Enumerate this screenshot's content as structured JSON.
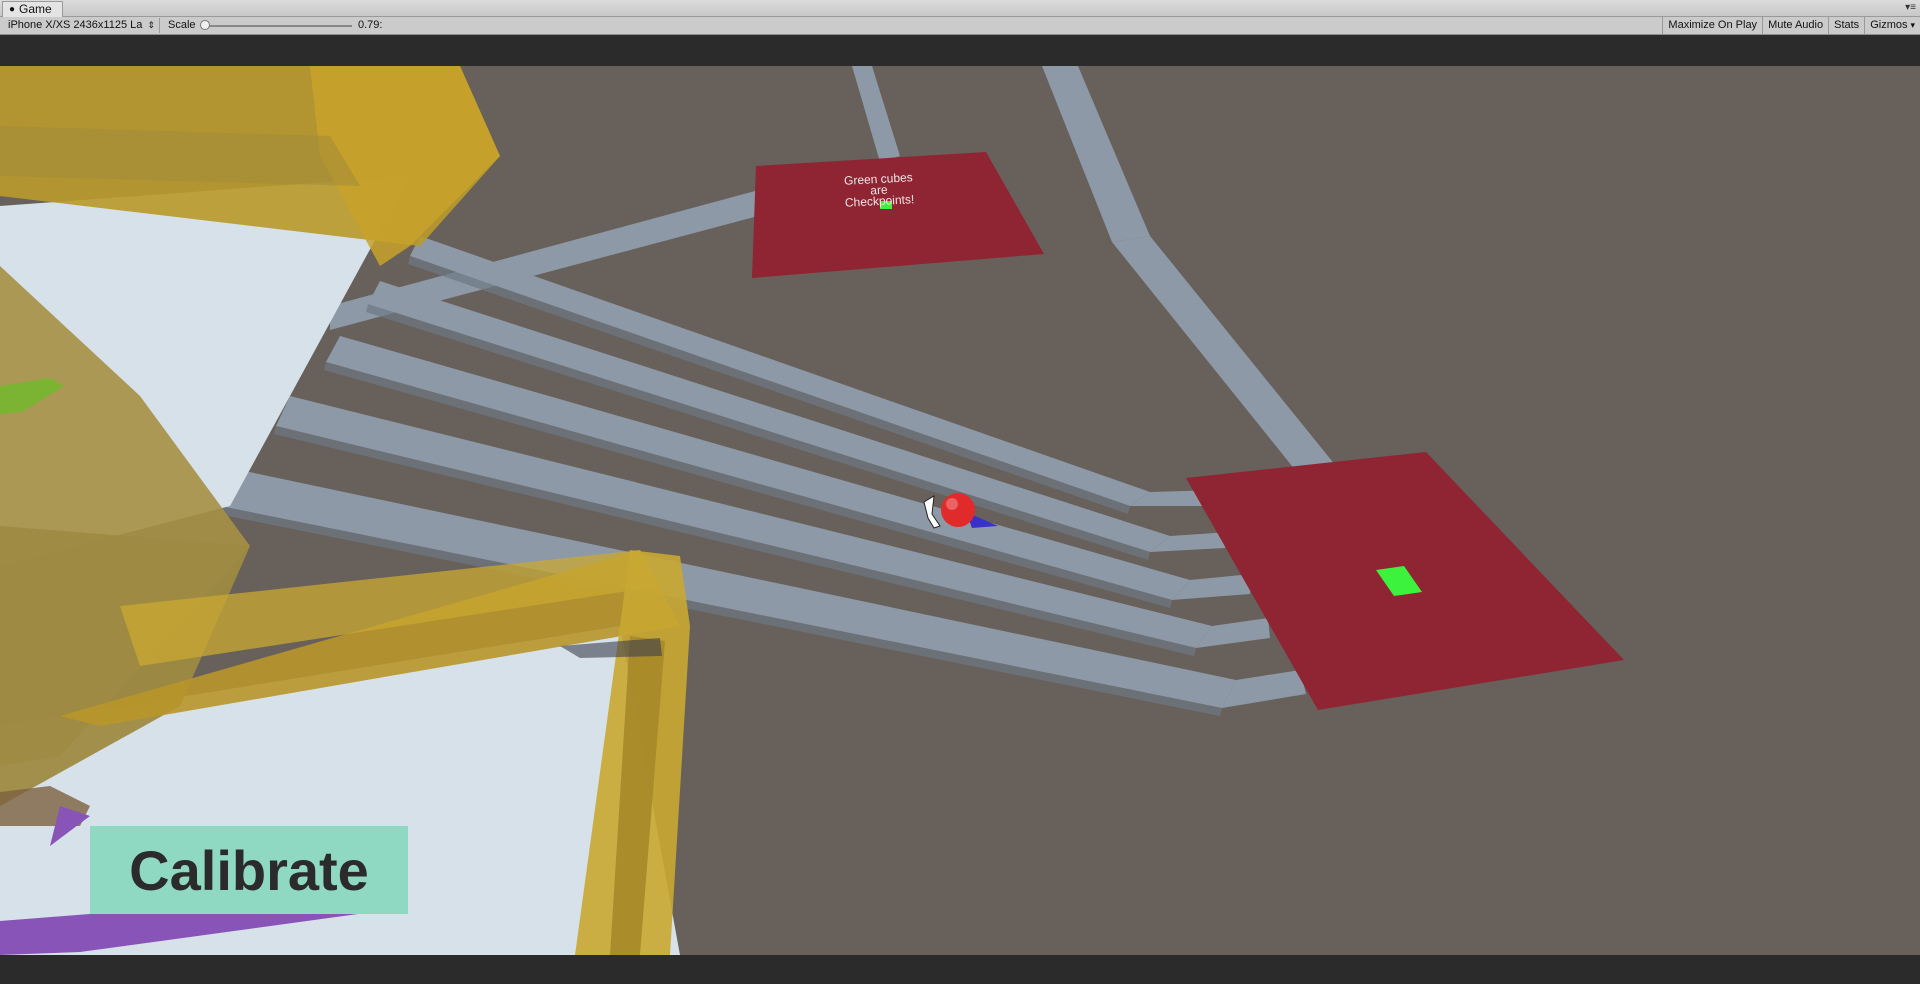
{
  "window": {
    "tab_title": "Game",
    "tab_icon": "unity-icon"
  },
  "toolbar": {
    "resolution": "iPhone X/XS 2436x1125 La",
    "scale_label": "Scale",
    "scale_value": "0.79:",
    "scale_level": 0.0,
    "buttons": [
      "Maximize On Play",
      "Mute Audio",
      "Stats",
      "Gizmos"
    ]
  },
  "scene": {
    "sign_text": "Green cubes\nare\nCheckpoints!",
    "calibrate_label": "Calibrate",
    "colors": {
      "ground": "#68605a",
      "path": "#8d99a6",
      "pad": "#8f2433",
      "checkpoint": "#3df23d",
      "ball": "#e12a2a",
      "gold_glass": "#c8a22a",
      "calibrate_bg": "#8fd9c3"
    }
  }
}
